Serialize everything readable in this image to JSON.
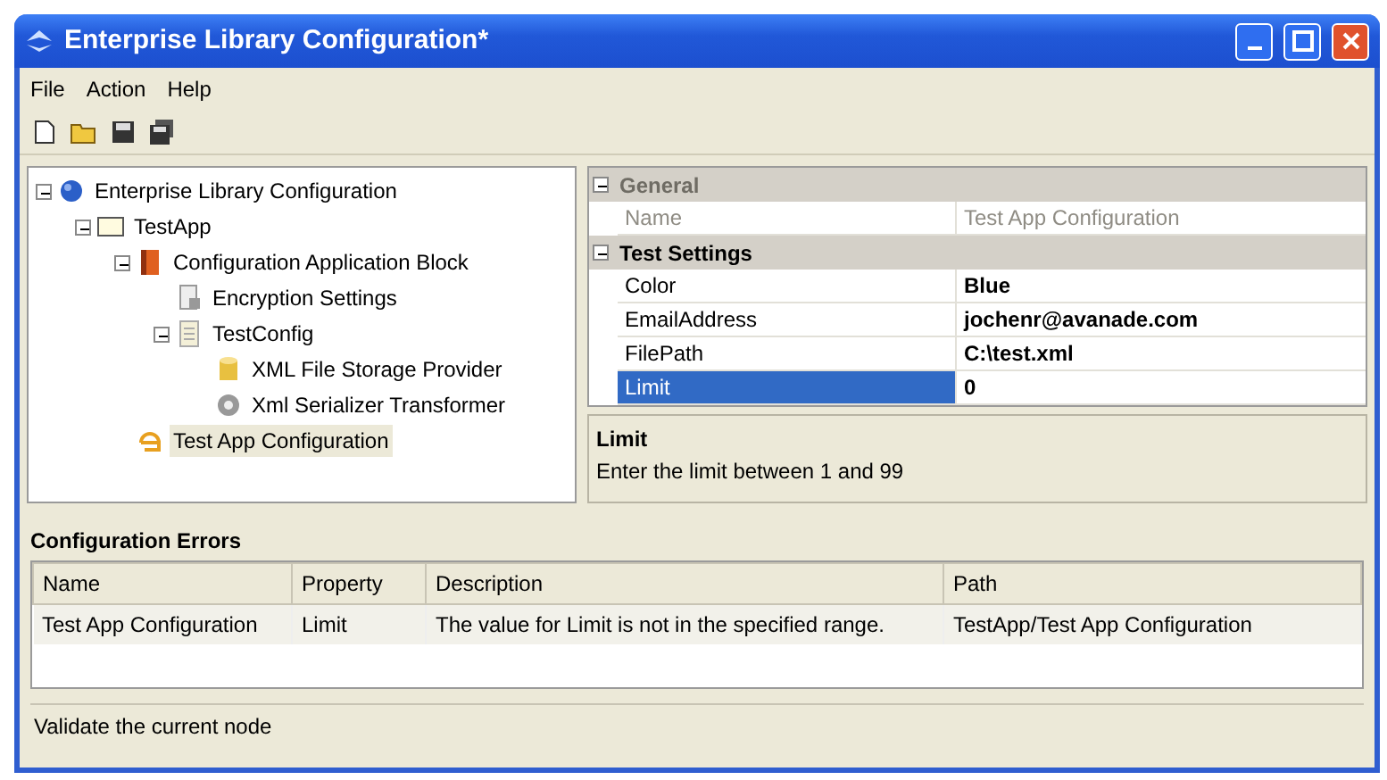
{
  "window": {
    "title": "Enterprise Library Configuration*"
  },
  "menu": [
    "File",
    "Action",
    "Help"
  ],
  "toolbar": [
    {
      "kind": "new"
    },
    {
      "kind": "open"
    },
    {
      "kind": "save"
    },
    {
      "kind": "saveall"
    }
  ],
  "tree": [
    {
      "label": "Enterprise Library Configuration",
      "kind": "globe",
      "expanded": true,
      "selected": false,
      "children": [
        {
          "label": "TestApp",
          "kind": "window",
          "expanded": true,
          "selected": false,
          "children": [
            {
              "label": "Configuration Application Block",
              "kind": "book",
              "expanded": true,
              "selected": false,
              "children": [
                {
                  "label": "Encryption Settings",
                  "kind": "lock",
                  "selected": false
                },
                {
                  "label": "TestConfig",
                  "kind": "doc",
                  "expanded": true,
                  "selected": false,
                  "children": [
                    {
                      "label": "XML File Storage Provider",
                      "kind": "cylinder",
                      "selected": false
                    },
                    {
                      "label": "Xml Serializer Transformer",
                      "kind": "gear",
                      "selected": false
                    }
                  ]
                }
              ]
            },
            {
              "label": "Test App Configuration",
              "kind": "hook",
              "selected": true
            }
          ]
        }
      ]
    }
  ],
  "properties": [
    {
      "category": "General",
      "expanded": true,
      "disabled": true,
      "items": [
        {
          "name": "Name",
          "value": "Test App Configuration",
          "selected": false
        }
      ]
    },
    {
      "category": "Test Settings",
      "expanded": true,
      "disabled": false,
      "items": [
        {
          "name": "Color",
          "value": "Blue",
          "selected": false
        },
        {
          "name": "EmailAddress",
          "value": "jochenr@avanade.com",
          "selected": false
        },
        {
          "name": "FilePath",
          "value": "C:\\test.xml",
          "selected": false
        },
        {
          "name": "Limit",
          "value": "0",
          "selected": true
        }
      ]
    }
  ],
  "description": {
    "title": "Limit",
    "text": "Enter the limit between 1 and 99"
  },
  "errors": {
    "title": "Configuration Errors",
    "columns": [
      "Name",
      "Property",
      "Description",
      "Path"
    ],
    "rows": [
      [
        "Test App Configuration",
        "Limit",
        "The value for Limit is not in the specified range.",
        "TestApp/Test App Configuration"
      ]
    ]
  },
  "status_bar": "Validate the current node"
}
